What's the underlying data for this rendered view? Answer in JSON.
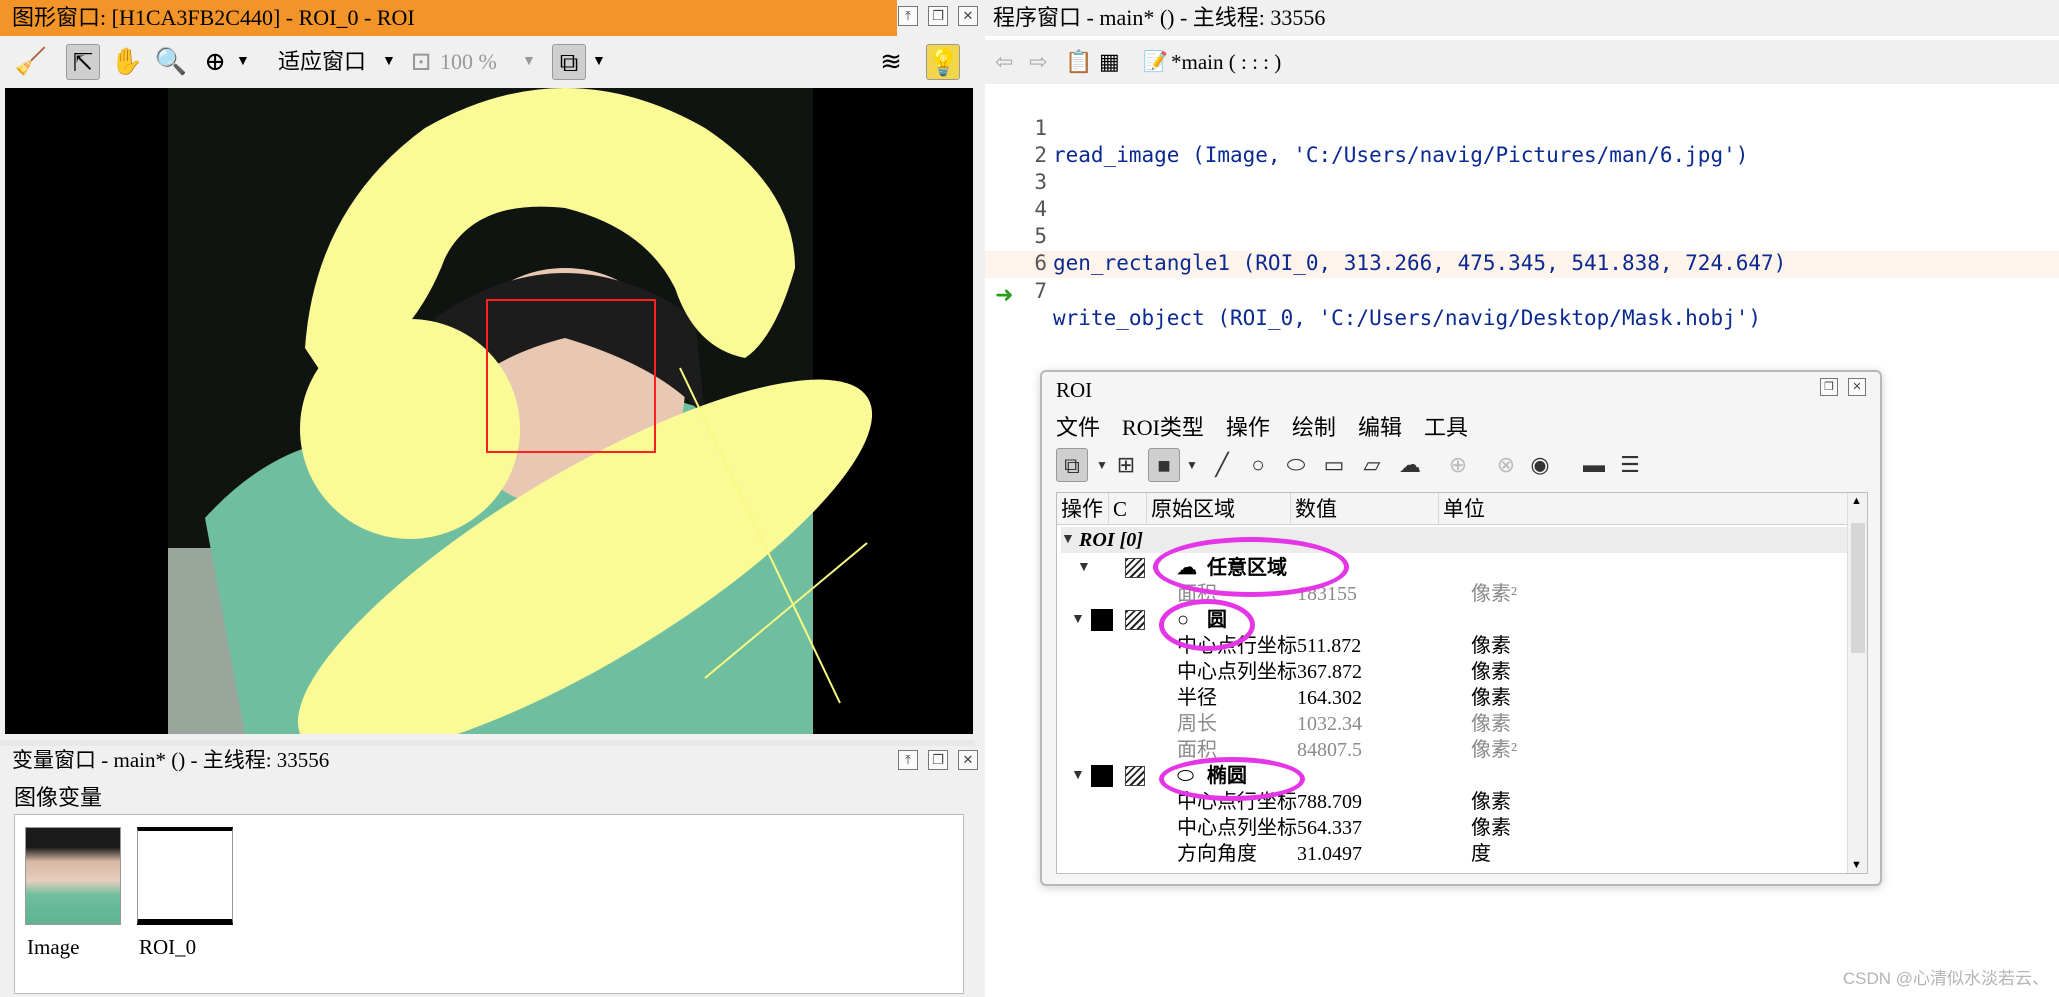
{
  "graphics_window": {
    "title": "图形窗口: [H1CA3FB2C440] - ROI_0 - ROI",
    "toolbar": {
      "fit_label": "适应窗口",
      "zoom_label": "100 %"
    }
  },
  "variable_window": {
    "title": "变量窗口 - main* () - 主线程: 33556",
    "section": "图像变量",
    "variables": [
      {
        "label": "Image"
      },
      {
        "label": "ROI_0"
      }
    ]
  },
  "program_window": {
    "title": "程序窗口 - main* () - 主线程: 33556",
    "procedure": "*main ( : : : )",
    "lines": [
      {
        "num": "1",
        "code": "read_image (Image, 'C:/Users/navig/Pictures/man/6.jpg')"
      },
      {
        "num": "2",
        "code": ""
      },
      {
        "num": "3",
        "code": ""
      },
      {
        "num": "4",
        "code": ""
      },
      {
        "num": "5",
        "code": "gen_rectangle1 (ROI_0, 313.266, 475.345, 541.838, 724.647)"
      },
      {
        "num": "6",
        "code": ""
      },
      {
        "num": "7",
        "code": "write_object (ROI_0, 'C:/Users/navig/Desktop/Mask.hobj')"
      }
    ]
  },
  "roi_dialog": {
    "title": "ROI",
    "menu": [
      "文件",
      "ROI类型",
      "操作",
      "绘制",
      "编辑",
      "工具"
    ],
    "columns": [
      "操作",
      "C",
      "原始区域",
      "数值",
      "单位"
    ],
    "group": "ROI [0]",
    "items": [
      {
        "name": "任意区域",
        "props": [
          {
            "label": "面积",
            "value": "183155",
            "unit": "像素²",
            "dim": true
          }
        ]
      },
      {
        "name": "圆",
        "props": [
          {
            "label": "中心点行坐标",
            "value": "511.872",
            "unit": "像素",
            "dim": false
          },
          {
            "label": "中心点列坐标",
            "value": "367.872",
            "unit": "像素",
            "dim": false
          },
          {
            "label": "半径",
            "value": "164.302",
            "unit": "像素",
            "dim": false
          },
          {
            "label": "周长",
            "value": "1032.34",
            "unit": "像素",
            "dim": true
          },
          {
            "label": "面积",
            "value": "84807.5",
            "unit": "像素²",
            "dim": true
          }
        ]
      },
      {
        "name": "椭圆",
        "props": [
          {
            "label": "中心点行坐标",
            "value": "788.709",
            "unit": "像素",
            "dim": false
          },
          {
            "label": "中心点列坐标",
            "value": "564.337",
            "unit": "像素",
            "dim": false
          },
          {
            "label": "方向角度",
            "value": "31.0497",
            "unit": "度",
            "dim": false
          }
        ]
      }
    ]
  },
  "watermark": "CSDN @心清似水淡若云、",
  "colors": {
    "title_accent": "#f39428",
    "roi_fill": "#fafa96",
    "highlight": "#e436e6",
    "code": "#0b2a91"
  }
}
